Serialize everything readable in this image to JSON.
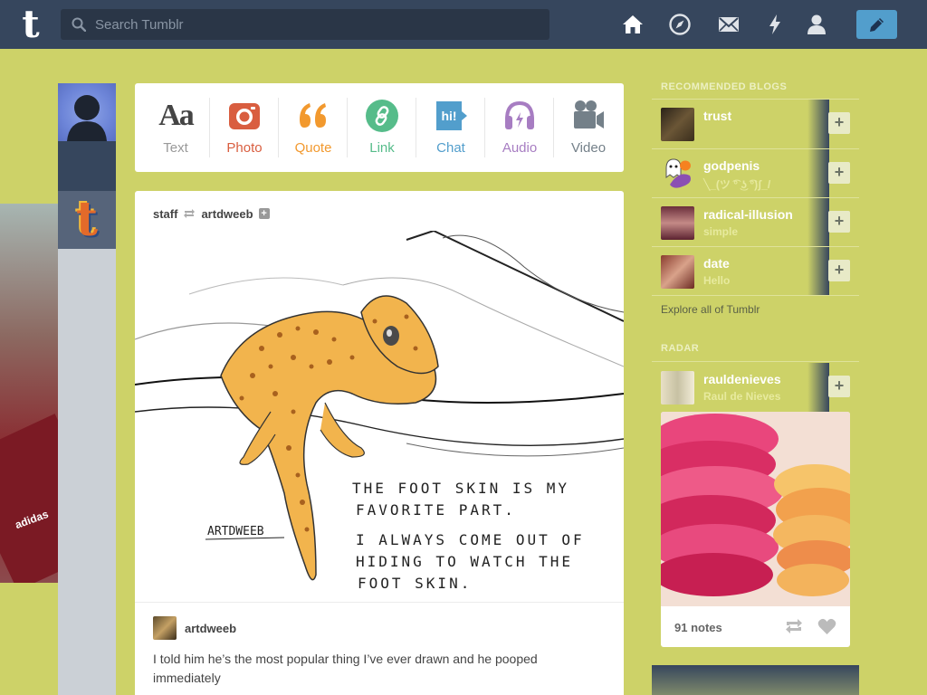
{
  "header": {
    "logo": "t",
    "search_placeholder": "Search Tumblr",
    "nav": [
      "home-icon",
      "explore-icon",
      "inbox-icon",
      "activity-icon",
      "account-icon"
    ],
    "compose_icon": "pencil-icon"
  },
  "post_types": [
    {
      "label": "Text",
      "icon": "text-icon",
      "color": "#444444",
      "glyph": "Aa"
    },
    {
      "label": "Photo",
      "icon": "camera-icon",
      "color": "#d95e40"
    },
    {
      "label": "Quote",
      "icon": "quote-icon",
      "color": "#f2992e"
    },
    {
      "label": "Link",
      "icon": "link-icon",
      "color": "#56bc8a"
    },
    {
      "label": "Chat",
      "icon": "chat-icon",
      "color": "#529ecc",
      "glyph": "hi!"
    },
    {
      "label": "Audio",
      "icon": "headphones-icon",
      "color": "#a77dc2"
    },
    {
      "label": "Video",
      "icon": "video-camera-icon",
      "color": "#748089"
    }
  ],
  "post": {
    "reblogger": "staff",
    "source": "artdweeb",
    "drawing_text": {
      "line1": "THE FOOT SKIN IS MY",
      "line2": "FAVORITE PART.",
      "line3": "I ALWAYS COME OUT OF",
      "line4": "HIDING TO WATCH THE",
      "line5": "FOOT SKIN.",
      "signature": "ARTDWEEB"
    },
    "caption_author": "artdweeb",
    "caption": "I told him he’s the most popular thing I’ve ever drawn and he pooped immediately"
  },
  "sidebar": {
    "recommended_title": "RECOMMENDED BLOGS",
    "blogs": [
      {
        "name": "trust",
        "title": "",
        "thumb": "#4a3a2a"
      },
      {
        "name": "godpenis",
        "title": "╲_(ツ ͡° ͜ʖ ͡°)ʃ_/",
        "thumb": "#d9c2e8"
      },
      {
        "name": "radical-illusion",
        "title": "simple",
        "thumb": "#7a3b4b"
      },
      {
        "name": "date",
        "title": "Hello",
        "thumb": "#b46a5a"
      }
    ],
    "explore_label": "Explore all of Tumblr",
    "radar_title": "RADAR",
    "radar": {
      "name": "rauldenieves",
      "title": "Raul de Nieves",
      "notes": "91 notes"
    }
  },
  "colors": {
    "header": "#36465d",
    "background": "#cdd268",
    "accent": "#529ecc"
  }
}
